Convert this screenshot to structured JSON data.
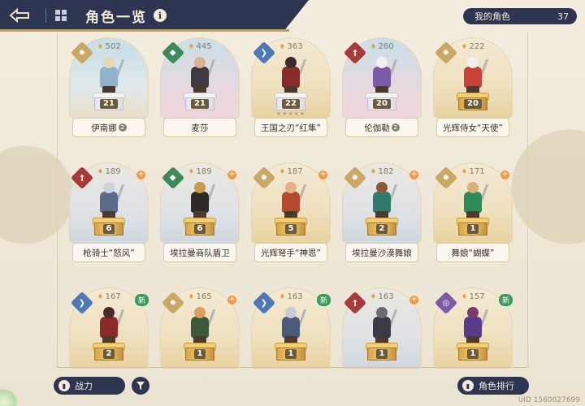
{
  "header": {
    "title": "角色一览",
    "info_glyph": "i"
  },
  "my_characters": {
    "label": "我的角色",
    "count": "37"
  },
  "cards": [
    {
      "name": "伊南娜",
      "power": "502",
      "level": "21",
      "rarity_icon": "gear-emblem",
      "rarity_color": "#c9a865",
      "bg": "blue",
      "pedestal": "white",
      "ring": "2"
    },
    {
      "name": "麦莎",
      "power": "445",
      "level": "21",
      "rarity_icon": "shield-emblem",
      "rarity_color": "#3f8a5a",
      "bg": "pink",
      "pedestal": "white"
    },
    {
      "name": "王国之刃“红隼”",
      "power": "363",
      "level": "22",
      "rarity_icon": "wing-emblem",
      "rarity_color": "#4c79b8",
      "bg": "gold",
      "pedestal": "white",
      "stars": "★★★★★"
    },
    {
      "name": "伦伽勒",
      "power": "260",
      "level": "20",
      "rarity_icon": "sword-emblem",
      "rarity_color": "#a83a3a",
      "bg": "pink",
      "pedestal": "white",
      "ring": "2"
    },
    {
      "name": "光辉侍女“天使”",
      "power": "222",
      "level": "20",
      "rarity_icon": "gear-emblem",
      "rarity_color": "#c9a865",
      "bg": "gold",
      "pedestal": "gold"
    },
    {
      "name": "枪骑士“怒风”",
      "power": "189",
      "level": "6",
      "rarity_icon": "sword-emblem",
      "rarity_color": "#a83a3a",
      "bg": "steel",
      "pedestal": "gold",
      "plus": "+"
    },
    {
      "name": "埃拉曼商队盾卫",
      "power": "189",
      "level": "6",
      "rarity_icon": "shield-emblem",
      "rarity_color": "#3f8a5a",
      "bg": "steel",
      "pedestal": "gold",
      "plus": "+"
    },
    {
      "name": "光辉弩手“神恩”",
      "power": "187",
      "level": "5",
      "rarity_icon": "gear-emblem",
      "rarity_color": "#c9a865",
      "bg": "gold",
      "pedestal": "gold",
      "plus": "+"
    },
    {
      "name": "埃拉曼沙漠舞娘",
      "power": "182",
      "level": "2",
      "rarity_icon": "gear-emblem",
      "rarity_color": "#c9a865",
      "bg": "steel",
      "pedestal": "gold",
      "plus": "+"
    },
    {
      "name": "舞娘“蝴蝶”",
      "power": "171",
      "level": "1",
      "rarity_icon": "gear-emblem",
      "rarity_color": "#c9a865",
      "bg": "gold",
      "pedestal": "gold",
      "plus": "+"
    },
    {
      "name": "",
      "power": "167",
      "level": "2",
      "rarity_icon": "wing-emblem",
      "rarity_color": "#4c79b8",
      "bg": "gold",
      "pedestal": "gold",
      "badge": "新"
    },
    {
      "name": "",
      "power": "165",
      "level": "1",
      "rarity_icon": "gear-emblem",
      "rarity_color": "#c9a865",
      "bg": "gold",
      "pedestal": "gold",
      "plus": "+"
    },
    {
      "name": "",
      "power": "163",
      "level": "1",
      "rarity_icon": "wing-emblem",
      "rarity_color": "#4c79b8",
      "bg": "gold",
      "pedestal": "gold",
      "badge": "新"
    },
    {
      "name": "",
      "power": "163",
      "level": "1",
      "rarity_icon": "sword-emblem",
      "rarity_color": "#a83a3a",
      "bg": "steel",
      "pedestal": "gold",
      "plus": "+"
    },
    {
      "name": "",
      "power": "157",
      "level": "1",
      "rarity_icon": "orb-emblem",
      "rarity_color": "#7d5aa8",
      "bg": "gold",
      "pedestal": "gold",
      "badge": "新"
    }
  ],
  "bottom": {
    "power_label": "战力",
    "rank_label": "角色排行",
    "uid": "UID 1560027699"
  }
}
